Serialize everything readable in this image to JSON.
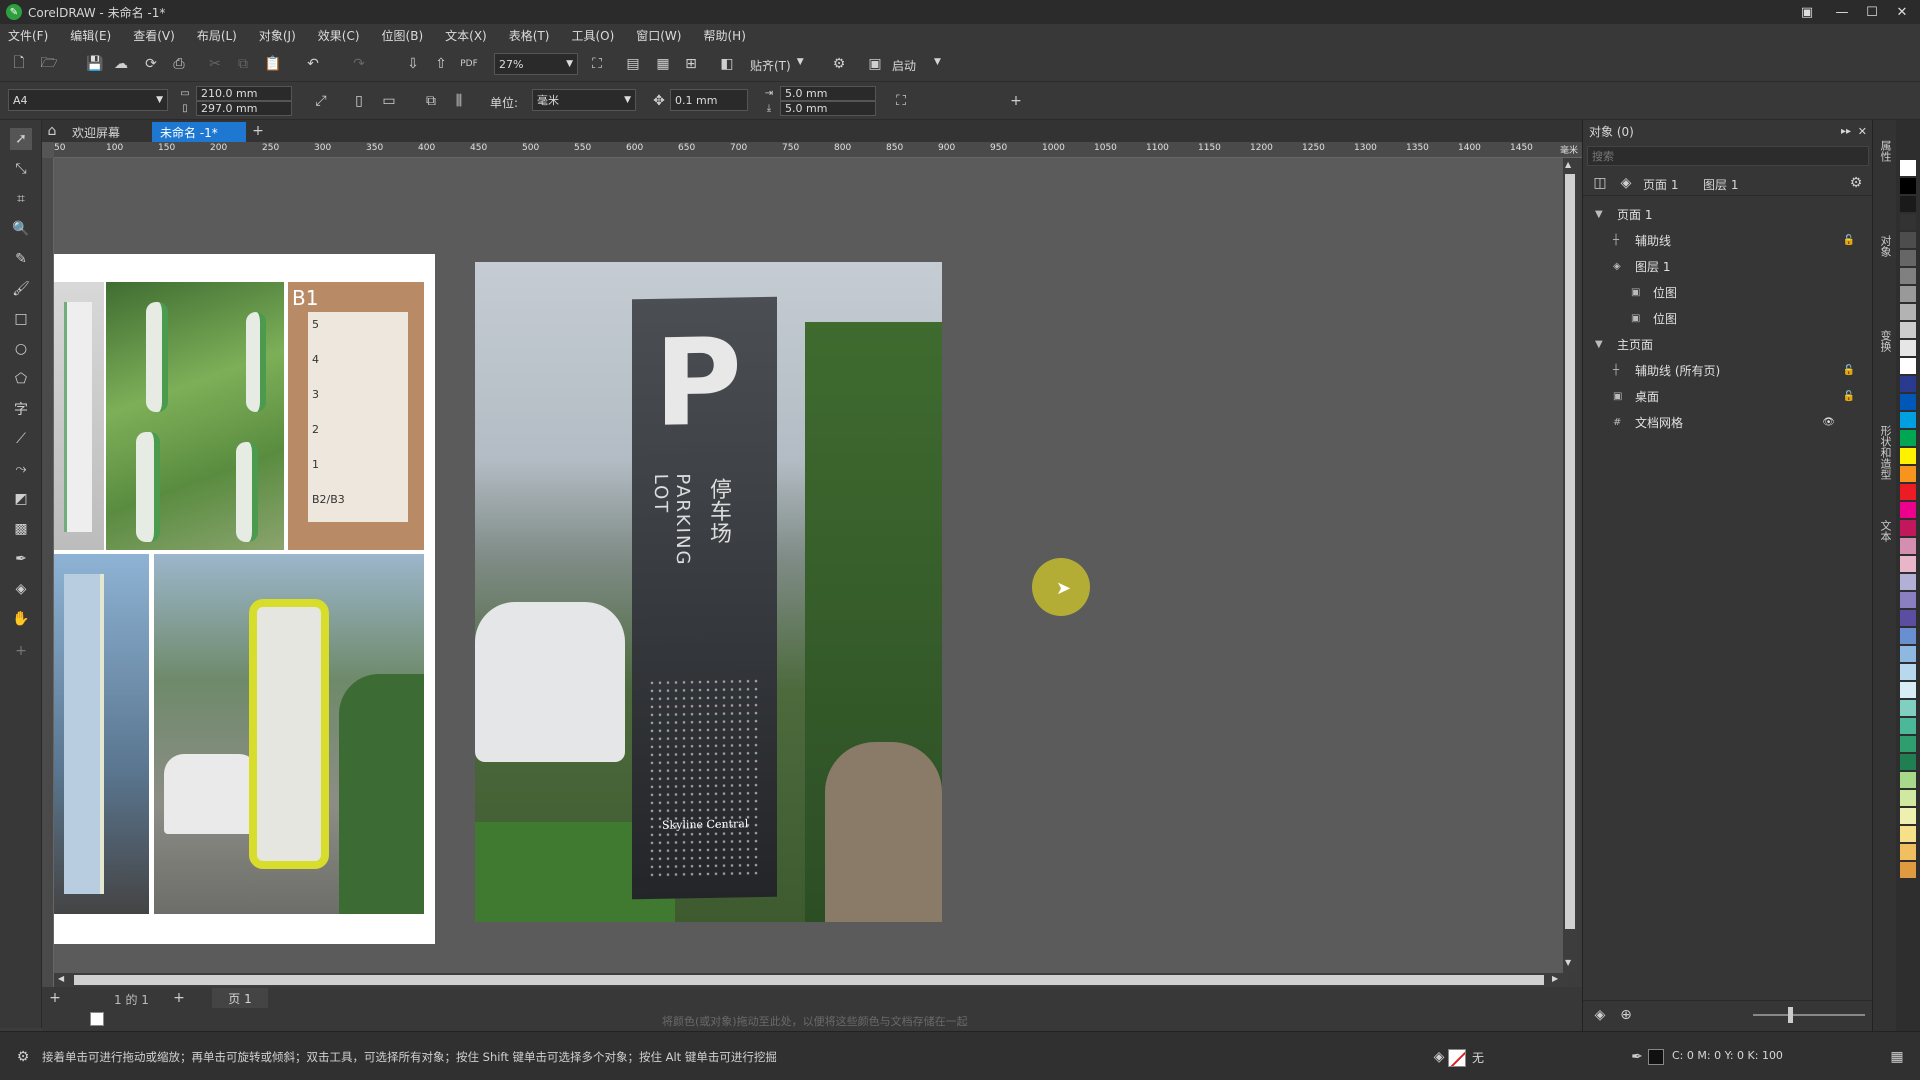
{
  "app": {
    "title": "CorelDRAW - 未命名 -1*"
  },
  "menu": [
    "文件(F)",
    "编辑(E)",
    "查看(V)",
    "布局(L)",
    "对象(J)",
    "效果(C)",
    "位图(B)",
    "文本(X)",
    "表格(T)",
    "工具(O)",
    "窗口(W)",
    "帮助(H)"
  ],
  "toolbar": {
    "zoom": "27%",
    "snap_label": "贴齐(T)",
    "launch_label": "启动"
  },
  "props": {
    "page_size": "A4",
    "width": "210.0 mm",
    "height": "297.0 mm",
    "unit_label": "单位:",
    "unit": "毫米",
    "nudge": "0.1 mm",
    "dup_x": "5.0 mm",
    "dup_y": "5.0 mm"
  },
  "tabs": {
    "welcome": "欢迎屏幕",
    "doc": "未命名 -1*"
  },
  "ruler_ticks": [
    "50",
    "100",
    "150",
    "200",
    "250",
    "300",
    "350",
    "400",
    "450",
    "500",
    "550",
    "600",
    "650",
    "700",
    "750",
    "800",
    "850",
    "900",
    "950",
    "1000",
    "1050",
    "1100",
    "1150",
    "1200",
    "1250",
    "1300",
    "1350",
    "1400",
    "1450"
  ],
  "ruler_unit": "毫米",
  "sign": {
    "letter": "P",
    "cn": "停车场",
    "en1": "PARKING",
    "en2": "LOT",
    "brand": "Skyline Central"
  },
  "mini_sign": {
    "floor": "B1",
    "levels": [
      "5",
      "4",
      "3",
      "2",
      "1",
      "B2/B3"
    ]
  },
  "pagebar": {
    "page_of": "1 的 1",
    "page_tab": "页 1"
  },
  "colorstrip_hint": "将颜色(或对象)拖动至此处，以便将这些颜色与文档存储在一起",
  "status": {
    "hint": "接着单击可进行拖动或缩放；再单击可旋转或倾斜；双击工具，可选择所有对象；按住 Shift 键单击可选择多个对象；按住 Alt 键单击可进行挖掘",
    "fill_label": "无",
    "outline": "C: 0 M: 0 Y: 0 K: 100"
  },
  "panel": {
    "title": "对象 (0)",
    "search_placeholder": "搜索",
    "page_selector": "页面 1",
    "layer_selector": "图层 1",
    "tree": [
      {
        "label": "页面 1",
        "level": 0,
        "icon": "expand-arrow"
      },
      {
        "label": "辅助线",
        "level": 1,
        "icon": "guides-icon"
      },
      {
        "label": "图层 1",
        "level": 1,
        "icon": "layer-icon"
      },
      {
        "label": "位图",
        "level": 2,
        "icon": "bitmap-icon"
      },
      {
        "label": "位图",
        "level": 2,
        "icon": "bitmap-icon"
      },
      {
        "label": "主页面",
        "level": 0,
        "icon": "expand-arrow"
      },
      {
        "label": "辅助线 (所有页)",
        "level": 1,
        "icon": "guides-icon"
      },
      {
        "label": "桌面",
        "level": 1,
        "icon": "desktop-icon"
      },
      {
        "label": "文档网格",
        "level": 1,
        "icon": "grid-icon"
      }
    ]
  },
  "dock_tabs": [
    "属性",
    "对象",
    "变换",
    "形状和造型",
    "文本"
  ],
  "palette_colors": [
    "#ffffff",
    "#000000",
    "#1a1a1a",
    "#333333",
    "#4d4d4d",
    "#666666",
    "#808080",
    "#999999",
    "#b3b3b3",
    "#cccccc",
    "#e6e6e6",
    "#ffffff",
    "#2a3a8f",
    "#0057b8",
    "#00a0e0",
    "#00a651",
    "#fff200",
    "#f7941d",
    "#ed1c24",
    "#ec008c",
    "#c2185b",
    "#d48fb0",
    "#e8b6c8",
    "#b3b0d8",
    "#8a7fc1",
    "#5b4da0",
    "#6a8fd0",
    "#8fb8e0",
    "#b8d8ee",
    "#d8ecf6",
    "#7fd0c0",
    "#4bb89a",
    "#2e9e6e",
    "#1f7f50",
    "#a8d88a",
    "#d0e8a0",
    "#eef0b0",
    "#f6e08a",
    "#f0c060",
    "#e09a40"
  ],
  "accent": "#1e78d2"
}
